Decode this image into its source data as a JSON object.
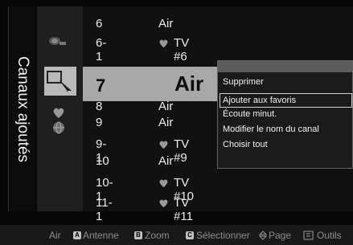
{
  "header": {
    "title": "Canaux ajoutés"
  },
  "channels": [
    {
      "num": "6",
      "name": "Air",
      "fav": false
    },
    {
      "num": "6-1",
      "name": "TV #6",
      "fav": true
    },
    {
      "num": "8",
      "name": "Air",
      "fav": false
    },
    {
      "num": "9",
      "name": "Air",
      "fav": false
    },
    {
      "num": "9-1",
      "name": "TV #9",
      "fav": true
    },
    {
      "num": "10",
      "name": "Air",
      "fav": false
    },
    {
      "num": "10-1",
      "name": "TV #10",
      "fav": true
    },
    {
      "num": "11-1",
      "name": "TV #11",
      "fav": true
    }
  ],
  "selected": {
    "num": "7",
    "name": "Air"
  },
  "menu": {
    "items": [
      "Supprimer",
      "Ajouter aux favoris",
      "Écoute minut.",
      "Modifier le nom du canal",
      "Choisir tout"
    ],
    "selected_index": 1
  },
  "footer": {
    "air": "Air",
    "a_key": "A",
    "a_label": "Antenne",
    "b_key": "B",
    "b_label": "Zoom",
    "c_key": "C",
    "c_label": "Sélectionner",
    "page_label": "Page",
    "tools_label": "Outils"
  },
  "colors": {
    "a": "#c2c2c2",
    "b": "#c2c2c2",
    "c": "#c2c2c2"
  }
}
